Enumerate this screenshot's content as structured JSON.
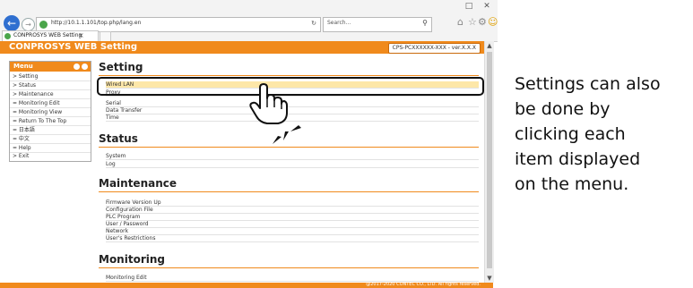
{
  "browser": {
    "window_controls": [
      "□",
      "✕"
    ],
    "url": "http://10.1.1.101/top.php/lang.en",
    "search_placeholder": "Search...",
    "tab_title": "CONPROSYS WEB Setting",
    "icons": [
      "back-arrow-icon",
      "forward-arrow-icon",
      "refresh-icon",
      "search-icon",
      "home-icon",
      "star-icon",
      "gear-icon",
      "smiley-icon"
    ]
  },
  "header": {
    "title": "CONPROSYS WEB Setting",
    "model_badge": "CPS-PCXXXXXX-XXX - ver.X.X.X",
    "color": "#f08a1c"
  },
  "menu": {
    "title": "Menu",
    "items": [
      {
        "label": "> Setting"
      },
      {
        "label": "> Status"
      },
      {
        "label": "> Maintenance"
      },
      {
        "label": "= Monitoring Edit"
      },
      {
        "label": "= Monitoring View"
      },
      {
        "label": "= Return To The Top"
      },
      {
        "label": "= 日本語"
      },
      {
        "label": "= 中文"
      },
      {
        "label": "= Help"
      },
      {
        "label": "> Exit"
      }
    ]
  },
  "sections": {
    "setting": {
      "title": "Setting",
      "items": [
        "Wired LAN",
        "Proxy",
        "Serial",
        "Data Transfer",
        "Time"
      ]
    },
    "status": {
      "title": "Status",
      "items": [
        "System",
        "Log"
      ]
    },
    "maintenance": {
      "title": "Maintenance",
      "items": [
        "Firmware Version Up",
        "Configuration File",
        "PLC Program",
        "User / Password",
        "Network",
        "User's Restrictions"
      ]
    },
    "monitoring": {
      "title": "Monitoring",
      "items": [
        "Monitoring Edit"
      ]
    }
  },
  "footer": {
    "copyright": "@2017-2020 CONTEC CO., LTD. All rights reserved."
  },
  "caption": {
    "lines": [
      "Settings can also",
      "be done by",
      "clicking each",
      "item displayed",
      "on the menu."
    ]
  }
}
